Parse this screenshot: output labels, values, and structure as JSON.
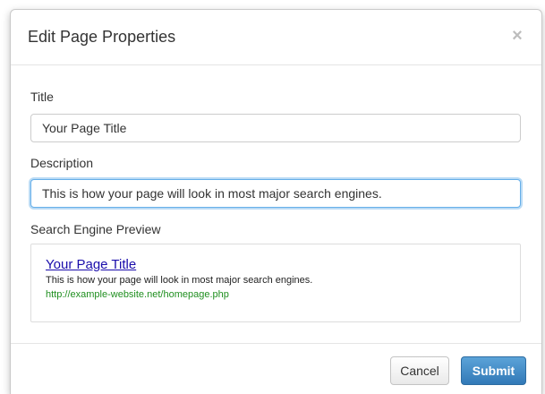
{
  "dialog": {
    "title": "Edit Page Properties",
    "close_glyph": "×"
  },
  "form": {
    "title_label": "Title",
    "title_value": "Your Page Title",
    "description_label": "Description",
    "description_value": "This is how your page will look in most major search engines.",
    "preview_label": "Search Engine Preview"
  },
  "preview": {
    "title": "Your Page Title",
    "description": "This is how your page will look in most major search engines.",
    "url": "http://example-website.net/homepage.php"
  },
  "footer": {
    "cancel_label": "Cancel",
    "submit_label": "Submit"
  },
  "colors": {
    "link": "#1a0dab",
    "url": "#1f8f1f",
    "primary": "#3279b7",
    "focus": "#66afe9"
  }
}
